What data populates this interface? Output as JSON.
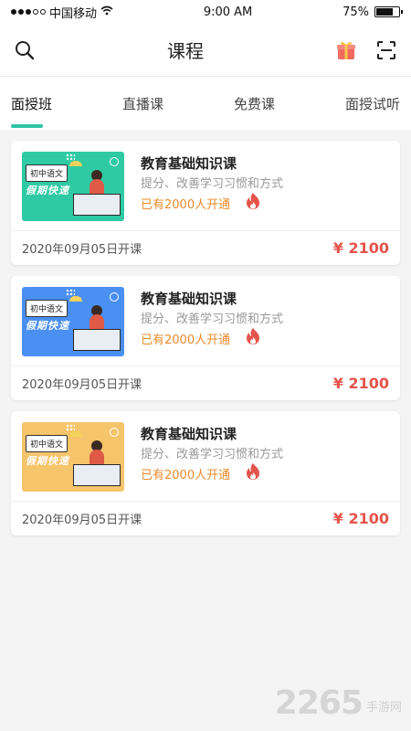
{
  "status": {
    "carrier": "中国移动",
    "time": "9:00 AM",
    "battery": "75%",
    "battery_level": 0.75
  },
  "nav": {
    "title": "课程",
    "left_icon": "search-icon",
    "right_icons": [
      "gift-icon",
      "scan-icon"
    ]
  },
  "tabs": [
    {
      "label": "面授班",
      "active": true
    },
    {
      "label": "直播课",
      "active": false
    },
    {
      "label": "免费课",
      "active": false
    },
    {
      "label": "面授试听",
      "active": false
    }
  ],
  "courses": [
    {
      "thumb_color": "#2fcaa3",
      "thumb_tag": "初中语文",
      "thumb_slogan": "假期快速",
      "title": "教育基础知识课",
      "subtitle": "提分、改善学习习惯和方式",
      "enrolled": "已有2000人开通",
      "date": "2020年09月05日开课",
      "price": "¥ 2100"
    },
    {
      "thumb_color": "#4a8ff2",
      "thumb_tag": "初中语文",
      "thumb_slogan": "假期快速",
      "title": "教育基础知识课",
      "subtitle": "提分、改善学习习惯和方式",
      "enrolled": "已有2000人开通",
      "date": "2020年09月05日开课",
      "price": "¥ 2100"
    },
    {
      "thumb_color": "#f6c46a",
      "thumb_tag": "初中语文",
      "thumb_slogan": "假期快速",
      "title": "教育基础知识课",
      "subtitle": "提分、改善学习习惯和方式",
      "enrolled": "已有2000人开通",
      "date": "2020年09月05日开课",
      "price": "¥ 2100"
    }
  ],
  "watermark": {
    "number": "2265",
    "text": "手游网"
  },
  "colors": {
    "accent": "#2ec4a6",
    "price": "#e5544b",
    "enrolled": "#e98a2a",
    "fire": "#e5544b"
  }
}
